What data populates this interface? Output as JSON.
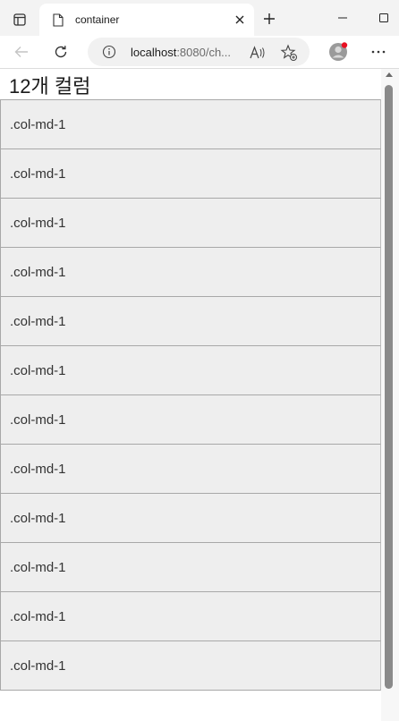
{
  "browser": {
    "tab": {
      "title": "container",
      "favicon": "document-icon"
    },
    "address": {
      "host": "localhost",
      "rest": ":8080/ch..."
    },
    "icons": {
      "tab_actions": "tab-actions-icon",
      "close": "close-icon",
      "new_tab": "plus-icon",
      "back": "back-arrow-icon",
      "refresh": "refresh-icon",
      "site_info": "info-icon",
      "read_aloud": "read-aloud-icon",
      "favorite": "favorite-add-icon",
      "profile": "avatar",
      "menu": "more-icon"
    }
  },
  "page": {
    "heading": "12개 컬럼",
    "cells": [
      ".col-md-1",
      ".col-md-1",
      ".col-md-1",
      ".col-md-1",
      ".col-md-1",
      ".col-md-1",
      ".col-md-1",
      ".col-md-1",
      ".col-md-1",
      ".col-md-1",
      ".col-md-1",
      ".col-md-1"
    ]
  },
  "colors": {
    "cell_background": "#eeeeee",
    "cell_border": "#a8a8a8",
    "profile_badge": "#e81123"
  }
}
